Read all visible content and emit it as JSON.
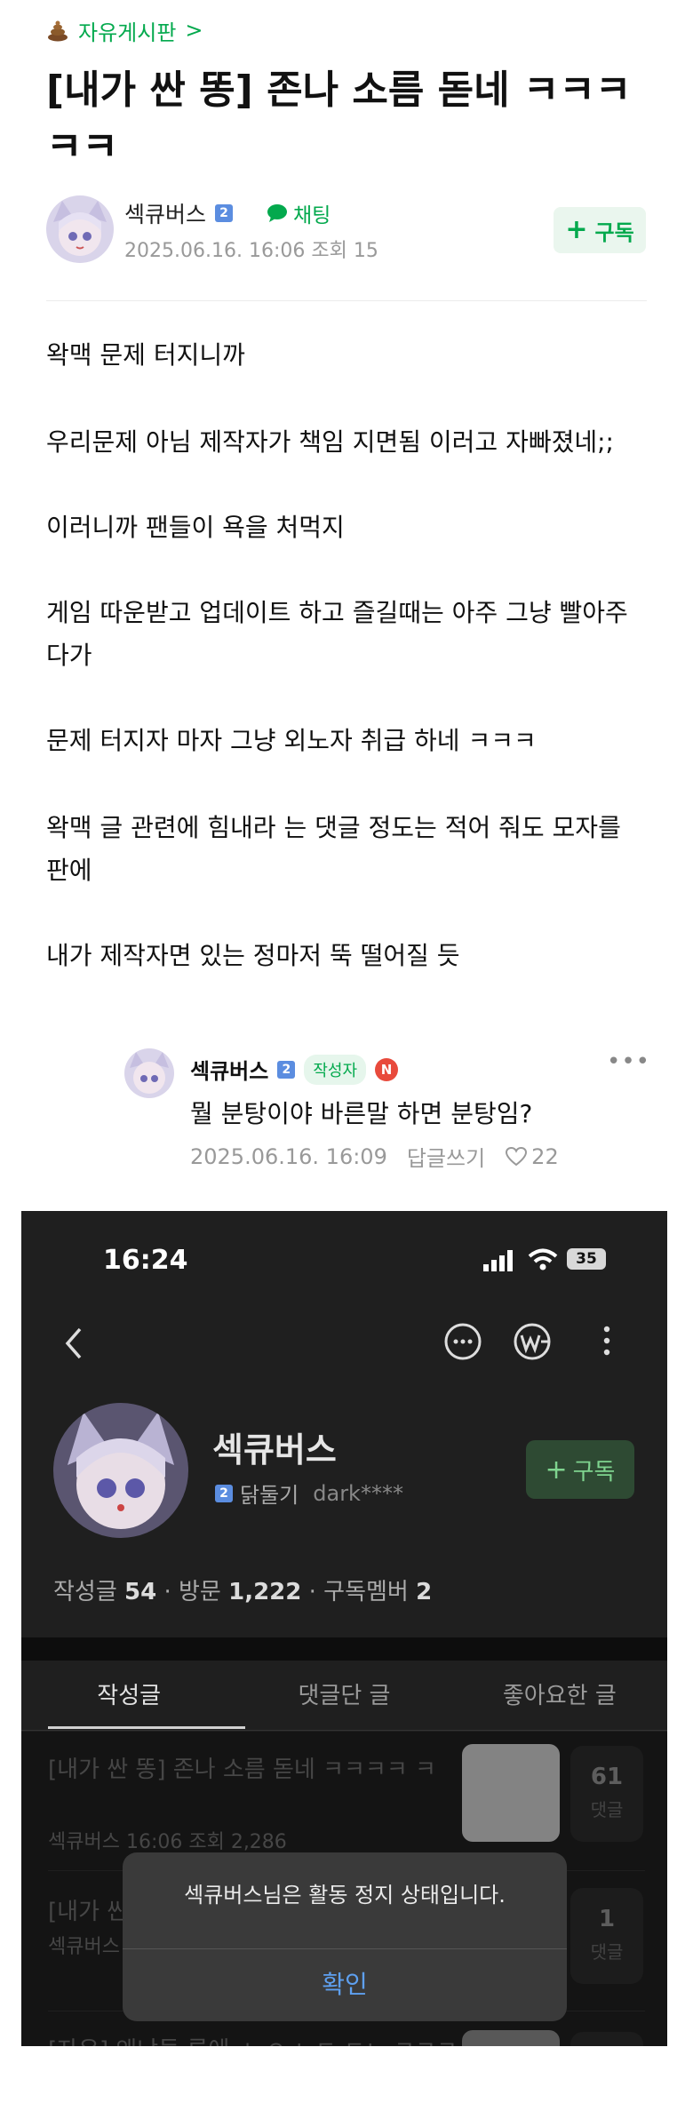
{
  "board": {
    "icon": "poop-icon",
    "name": "자유게시판",
    "chevron": ">"
  },
  "post": {
    "title": "[내가 싼 똥] 존나 소름 돋네 ㅋㅋㅋ ㅋㅋ",
    "author": "섹큐버스",
    "level": "2",
    "chat_label": "채팅",
    "meta": "2025.06.16. 16:06  조회 15",
    "subscribe_label": "구독",
    "paragraphs": [
      "왁맥 문제 터지니까",
      "우리문제 아님 제작자가 책임 지면됨 이러고 자빠졌네;;",
      "이러니까 팬들이 욕을 처먹지",
      "게임 따운받고 업데이트 하고 즐길때는 아주 그냥 빨아주다가",
      "문제 터지자 마자 그냥 외노자 취급 하네 ㅋㅋㅋ",
      "왁맥 글 관련에 힘내라 는 댓글 정도는 적어 줘도 모자를 판에",
      "내가 제작자면 있는 정마저 뚝 떨어질 듯"
    ]
  },
  "comment": {
    "author": "섹큐버스",
    "level": "2",
    "writer_badge": "작성자",
    "new_badge": "N",
    "text": "뭘 분탕이야 바른말 하면 분탕임?",
    "date": "2025.06.16. 16:09",
    "reply_label": "답글쓰기",
    "likes": "22"
  },
  "phone": {
    "status_time": "16:24",
    "battery": "35",
    "profile_name": "섹큐버스",
    "level": "2",
    "grade": "닭둘기",
    "user_id": "dark****",
    "subscribe_label": "구독",
    "stats": {
      "posts_label": "작성글",
      "posts": "54",
      "visits_label": "방문",
      "visits": "1,222",
      "members_label": "구독멤버",
      "members": "2"
    },
    "tabs": [
      "작성글",
      "댓글단 글",
      "좋아요한 글"
    ],
    "list": [
      {
        "title": "[내가 싼 똥] 존나 소름 돋네 ㅋㅋㅋㅋ ㅋ",
        "meta": "섹큐버스  16:06  조회 2,286",
        "count": "61",
        "count_label": "댓글"
      },
      {
        "title": "[내가 싼",
        "meta": "섹큐버스",
        "count": "1",
        "count_label": "댓글"
      },
      {
        "title": "[자유] 왜냐들 룩에 ㅅ ㅇ ㄴㄷ ㄷㄴ ㅋㅋㅋ"
      }
    ],
    "dialog": {
      "message": "섹큐버스님은 활동 정지 상태입니다.",
      "confirm": "확인"
    }
  }
}
